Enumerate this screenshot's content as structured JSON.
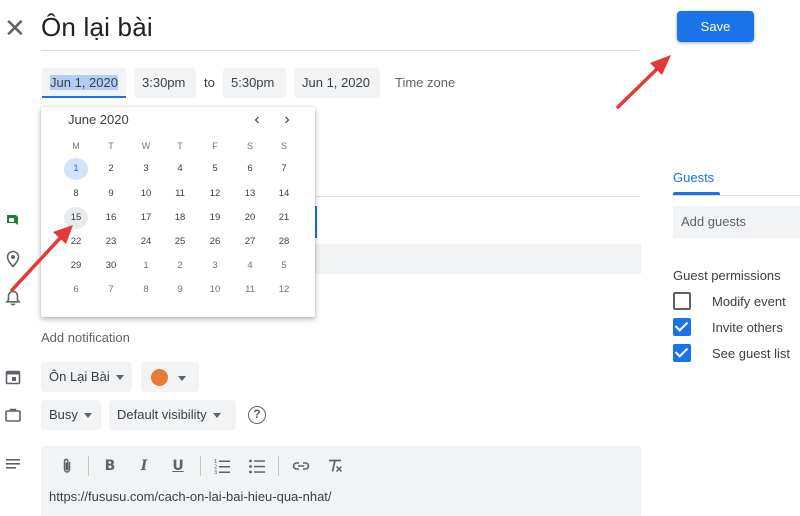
{
  "header": {
    "close_glyph": "✕",
    "title": "Ôn lại bài",
    "save_label": "Save"
  },
  "datetime": {
    "start_date": "Jun 1, 2020",
    "start_time": "3:30pm",
    "to_label": "to",
    "end_time": "5:30pm",
    "end_date": "Jun 1, 2020",
    "timezone_label": "Time zone"
  },
  "datepicker": {
    "month_label": "June 2020",
    "prev_glyph": "‹",
    "next_glyph": "›",
    "weekdays": [
      "M",
      "T",
      "W",
      "T",
      "F",
      "S",
      "S"
    ],
    "weeks": [
      [
        "1",
        "2",
        "3",
        "4",
        "5",
        "6",
        "7"
      ],
      [
        "8",
        "9",
        "10",
        "11",
        "12",
        "13",
        "14"
      ],
      [
        "15",
        "16",
        "17",
        "18",
        "19",
        "20",
        "21"
      ],
      [
        "22",
        "23",
        "24",
        "25",
        "26",
        "27",
        "28"
      ],
      [
        "29",
        "30",
        "1",
        "2",
        "3",
        "4",
        "5"
      ],
      [
        "6",
        "7",
        "8",
        "9",
        "10",
        "11",
        "12"
      ]
    ],
    "selected_day": "1",
    "hovered_day": "15"
  },
  "details": {
    "add_notification": "Add notification",
    "calendar_name": "Ôn Lại Bài",
    "event_color": "#e67c36",
    "busy_label": "Busy",
    "visibility_label": "Default visibility",
    "help_glyph": "?",
    "description": "https://fususu.com/cach-on-lai-bai-hieu-qua-nhat/"
  },
  "guests": {
    "tab_label": "Guests",
    "add_placeholder": "Add guests",
    "permissions_title": "Guest permissions",
    "permissions": [
      {
        "label": "Modify event",
        "checked": false
      },
      {
        "label": "Invite others",
        "checked": true
      },
      {
        "label": "See guest list",
        "checked": true
      }
    ]
  },
  "colors": {
    "accent": "#1a73e8",
    "annotation_arrow": "#e53935"
  }
}
